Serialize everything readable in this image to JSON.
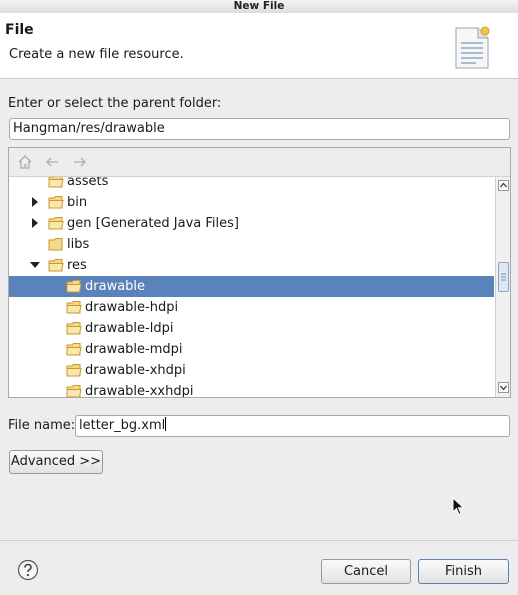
{
  "window": {
    "title": "New File"
  },
  "header": {
    "title": "File",
    "description": "Create a new file resource.",
    "image_icon": "new-file-wizard-icon"
  },
  "parent_folder": {
    "label": "Enter or select the parent folder:",
    "value": "Hangman/res/drawable"
  },
  "tree_toolbar": {
    "icons": [
      "home-icon",
      "back-arrow-icon",
      "forward-arrow-icon"
    ]
  },
  "tree": {
    "items": [
      {
        "label": "assets",
        "toggle": "none"
      },
      {
        "label": "bin",
        "toggle": "collapsed"
      },
      {
        "label": "gen [Generated Java Files]",
        "toggle": "collapsed"
      },
      {
        "label": "libs",
        "toggle": "none"
      },
      {
        "label": "res",
        "toggle": "expanded"
      },
      {
        "label": "drawable",
        "toggle": "none",
        "selected": true
      },
      {
        "label": "drawable-hdpi",
        "toggle": "none"
      },
      {
        "label": "drawable-ldpi",
        "toggle": "none"
      },
      {
        "label": "drawable-mdpi",
        "toggle": "none"
      },
      {
        "label": "drawable-xhdpi",
        "toggle": "none"
      },
      {
        "label": "drawable-xxhdpi",
        "toggle": "none"
      }
    ],
    "selected_color": "#5b83bb"
  },
  "file_name": {
    "label": "File name:",
    "value": "letter_bg.xml"
  },
  "buttons": {
    "advanced": "Advanced >>",
    "cancel": "Cancel",
    "finish": "Finish"
  },
  "footer": {
    "help_icon": "help-icon"
  }
}
